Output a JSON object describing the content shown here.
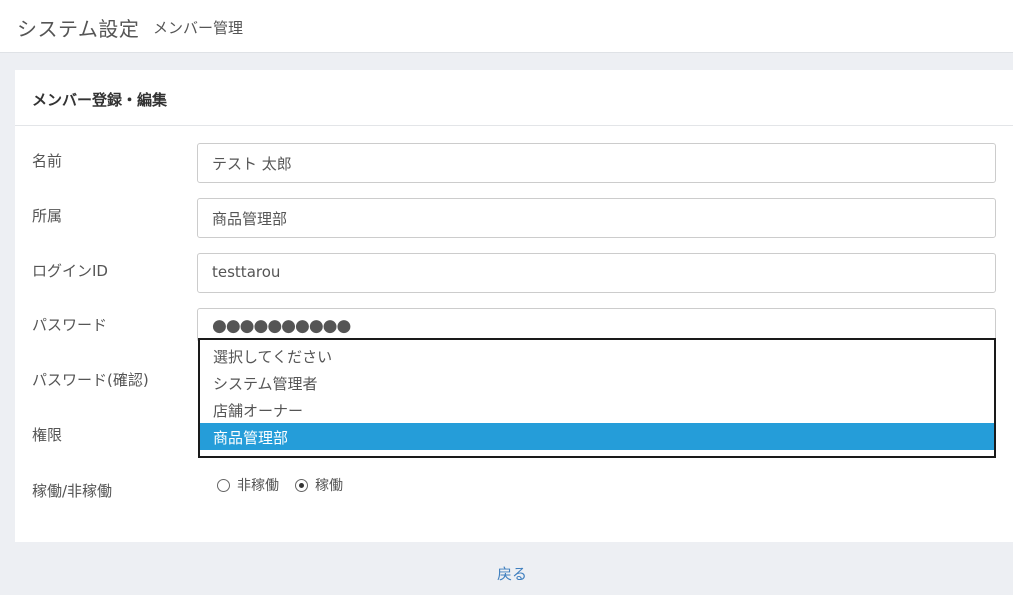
{
  "header": {
    "app_title": "システム設定",
    "page_title": "メンバー管理"
  },
  "card": {
    "title": "メンバー登録・編集"
  },
  "form": {
    "name_label": "名前",
    "name_value": "テスト 太郎",
    "dept_label": "所属",
    "dept_value": "商品管理部",
    "login_label": "ログインID",
    "login_value": "testtarou",
    "password_label": "パスワード",
    "password_value": "●●●●●●●●●●",
    "password_confirm_label": "パスワード(確認)",
    "role_label": "権限",
    "status_label": "稼働/非稼働"
  },
  "role_dropdown": {
    "options": [
      "選択してください",
      "システム管理者",
      "店舗オーナー",
      "商品管理部"
    ],
    "selected_index": 3
  },
  "status_radio": {
    "options": [
      "非稼働",
      "稼働"
    ],
    "selected_index": 1
  },
  "footer": {
    "back_label": "戻る"
  },
  "colors": {
    "selected_option_bg": "#259dd9",
    "link": "#3f7fbf",
    "page_bg": "#edeff3"
  }
}
